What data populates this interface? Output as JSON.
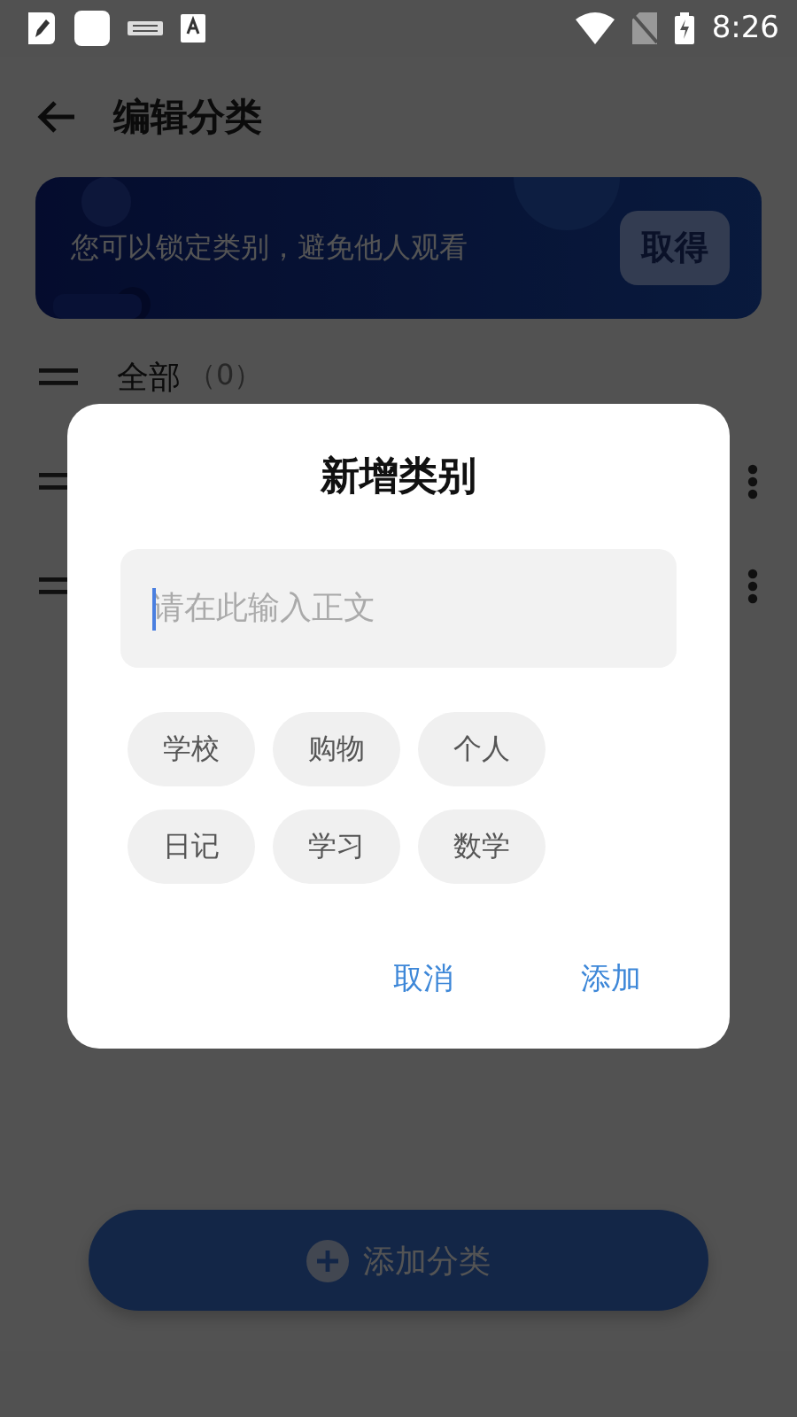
{
  "status_bar": {
    "time": "8:26"
  },
  "header": {
    "title": "编辑分类"
  },
  "banner": {
    "text": "您可以锁定类别，避免他人观看",
    "button": "取得"
  },
  "categories": [
    {
      "label": "全部",
      "count": "（0）",
      "menu": false
    },
    {
      "menu": true
    },
    {
      "menu": true
    }
  ],
  "add_button": {
    "label": "添加分类"
  },
  "dialog": {
    "title": "新增类别",
    "input": {
      "placeholder": "请在此输入正文"
    },
    "suggestions": [
      "学校",
      "购物",
      "个人",
      "日记",
      "学习",
      "数学"
    ],
    "buttons": [
      {
        "label": "取消"
      },
      {
        "label": "添加"
      }
    ]
  }
}
